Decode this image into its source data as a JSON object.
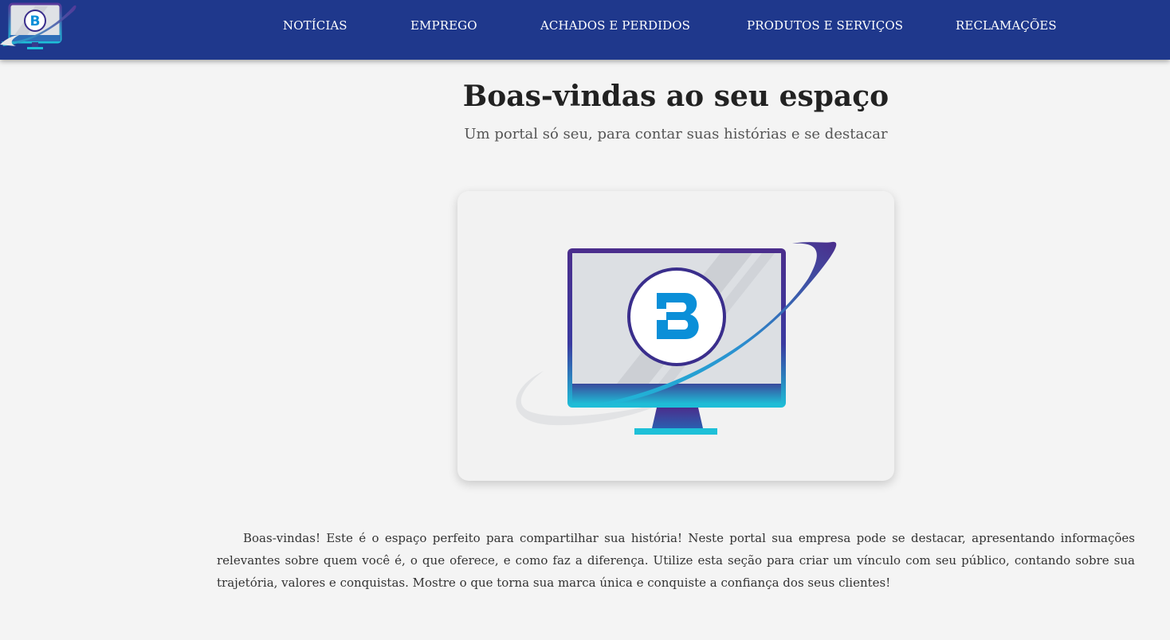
{
  "nav": {
    "items": [
      {
        "label": "NOTÍCIAS"
      },
      {
        "label": "EMPREGO"
      },
      {
        "label": "ACHADOS E PERDIDOS"
      },
      {
        "label": "PRODUTOS E SERVIÇOS"
      },
      {
        "label": "RECLAMAÇÕES"
      }
    ]
  },
  "hero": {
    "title": "Boas-vindas ao seu espaço",
    "subtitle": "Um portal só seu, para contar suas histórias e se destacar"
  },
  "logo": {
    "icon": "monitor-b-logo",
    "letter": "B"
  },
  "content": {
    "paragraph": "Boas-vindas! Este é o espaço perfeito para compartilhar sua história! Neste portal sua empresa pode se destacar, apresentando informações relevantes sobre quem você é, o que oferece, e como faz a diferença. Utilize esta seção para criar um vínculo com seu público, contando sobre sua trajetória, valores e conquistas. Mostre o que torna sua marca única e conquiste a confiança dos seus clientes!"
  },
  "colors": {
    "header_bg": "#1f388c",
    "page_bg": "#f4f4f4",
    "accent_blue": "#0a8fd8",
    "accent_purple": "#4b2e8c",
    "accent_cyan": "#1ec0d8"
  }
}
